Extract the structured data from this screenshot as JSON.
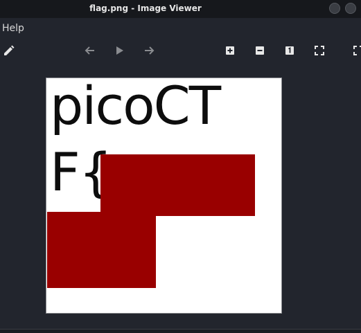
{
  "window": {
    "title": "flag.png - Image Viewer"
  },
  "menu": {
    "help_label": "Help"
  },
  "toolbar": {
    "icons": [
      "edit-icon",
      "back-icon",
      "play-icon",
      "forward-icon",
      "zoom-in-icon",
      "zoom-out-icon",
      "zoom-original-icon",
      "fit-icon",
      "fullscreen-icon"
    ]
  },
  "image": {
    "line1": "picoCT",
    "line2": "F{",
    "redaction_color": "#990000"
  }
}
